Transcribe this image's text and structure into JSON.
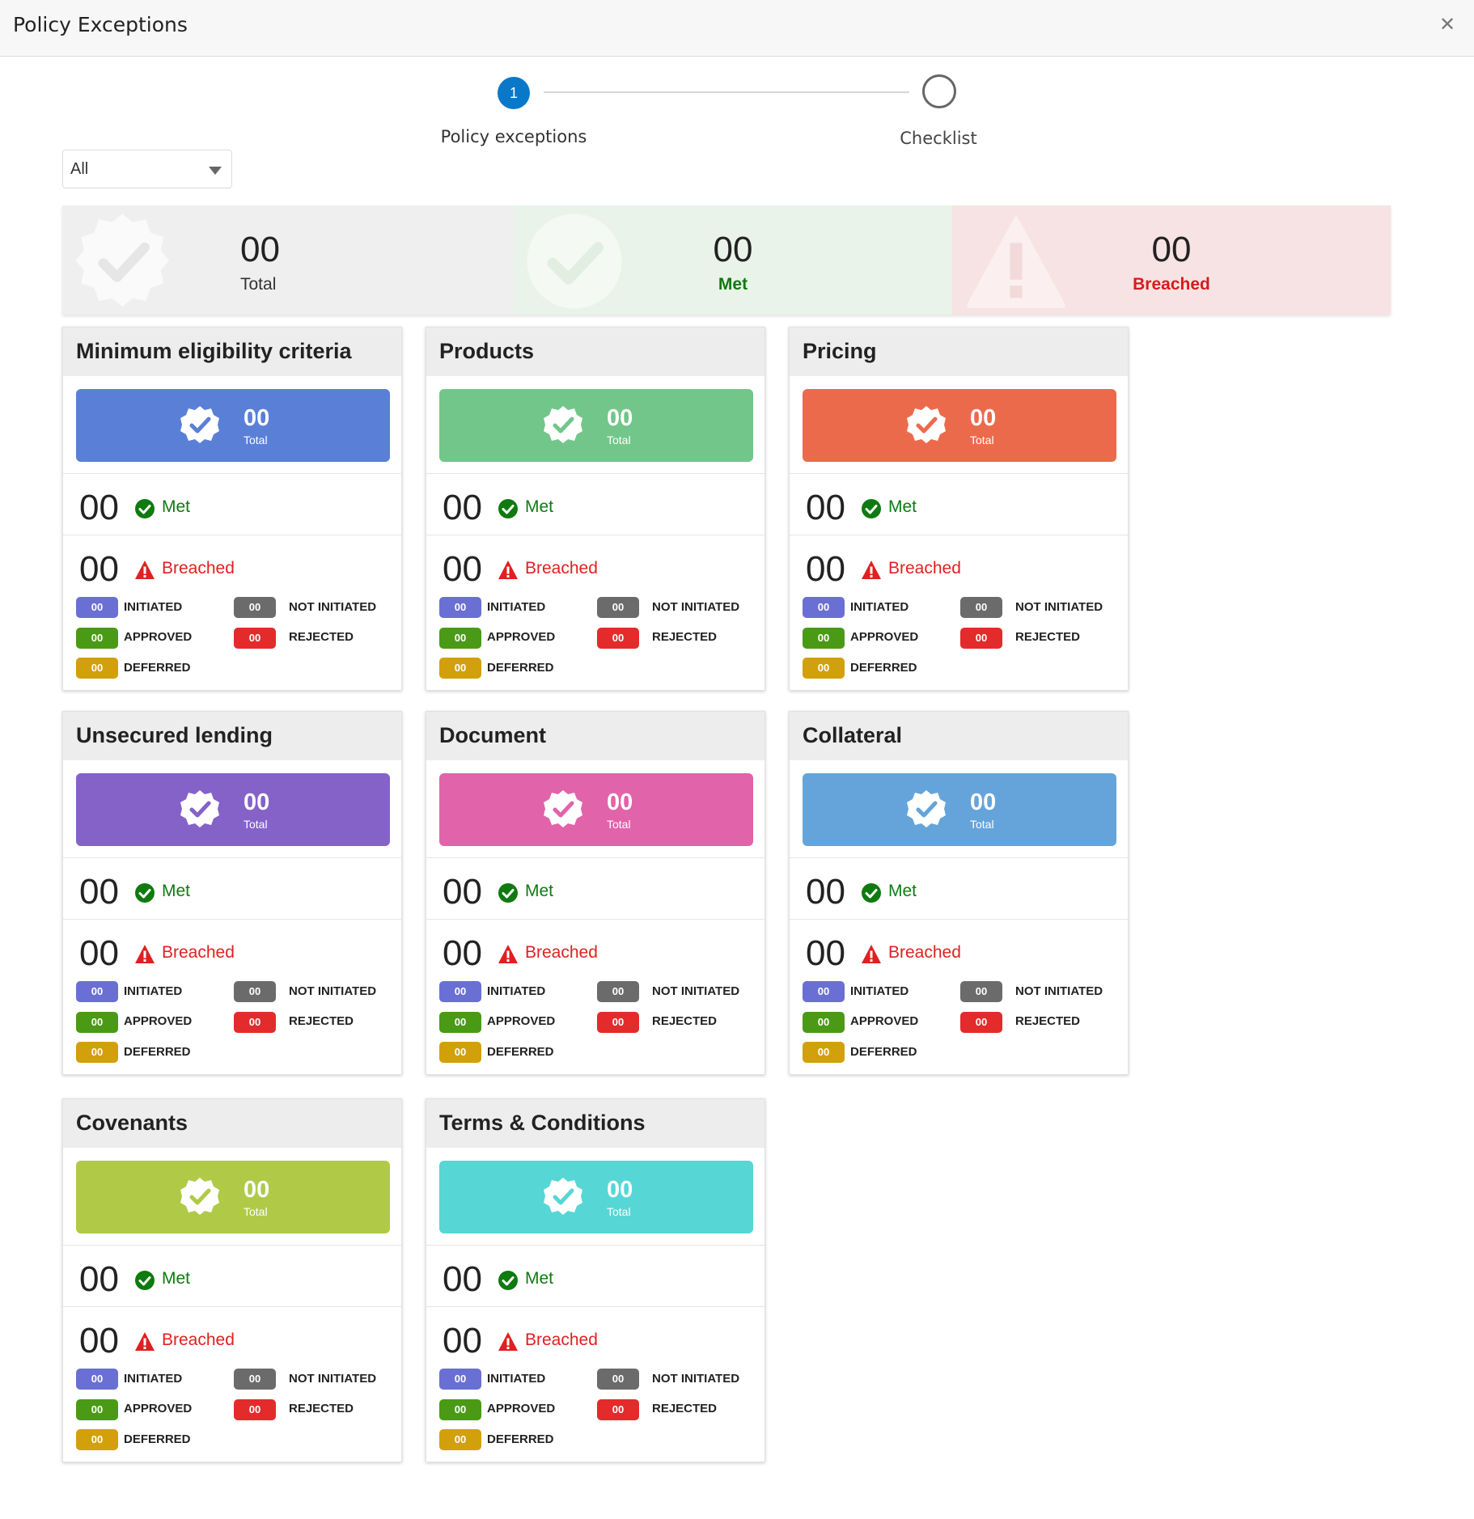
{
  "header": {
    "title": "Policy Exceptions",
    "close_icon": "close-icon"
  },
  "stepper": {
    "steps": [
      {
        "number": "1",
        "label": "Policy exceptions",
        "state": "active"
      },
      {
        "number": "",
        "label": "Checklist",
        "state": "inactive"
      }
    ],
    "active_color": "#0a78c8"
  },
  "filter": {
    "selected": "All"
  },
  "summary": {
    "total": {
      "value": "00",
      "label": "Total"
    },
    "met": {
      "value": "00",
      "label": "Met",
      "color": "#0f7a0f"
    },
    "breached": {
      "value": "00",
      "label": "Breached",
      "color": "#d81b1b"
    }
  },
  "status_colors": {
    "initiated": "#6a6fd4",
    "not_initiated": "#6b6b6b",
    "approved": "#4a9a16",
    "rejected": "#e32b2b",
    "deferred": "#d2a00a"
  },
  "cards": [
    {
      "title": "Minimum eligibility criteria",
      "color": "#5a7fd6",
      "total": "00",
      "total_label": "Total",
      "met": "00",
      "met_label": "Met",
      "breached": "00",
      "breached_label": "Breached",
      "statuses": {
        "initiated": {
          "count": "00",
          "label": "INITIATED"
        },
        "not_initiated": {
          "count": "00",
          "label": "NOT INITIATED"
        },
        "approved": {
          "count": "00",
          "label": "APPROVED"
        },
        "rejected": {
          "count": "00",
          "label": "REJECTED"
        },
        "deferred": {
          "count": "00",
          "label": "DEFERRED"
        }
      }
    },
    {
      "title": "Products",
      "color": "#72c689",
      "total": "00",
      "total_label": "Total",
      "met": "00",
      "met_label": "Met",
      "breached": "00",
      "breached_label": "Breached",
      "statuses": {
        "initiated": {
          "count": "00",
          "label": "INITIATED"
        },
        "not_initiated": {
          "count": "00",
          "label": "NOT INITIATED"
        },
        "approved": {
          "count": "00",
          "label": "APPROVED"
        },
        "rejected": {
          "count": "00",
          "label": "REJECTED"
        },
        "deferred": {
          "count": "00",
          "label": "DEFERRED"
        }
      }
    },
    {
      "title": "Pricing",
      "color": "#ec6a4c",
      "total": "00",
      "total_label": "Total",
      "met": "00",
      "met_label": "Met",
      "breached": "00",
      "breached_label": "Breached",
      "statuses": {
        "initiated": {
          "count": "00",
          "label": "INITIATED"
        },
        "not_initiated": {
          "count": "00",
          "label": "NOT INITIATED"
        },
        "approved": {
          "count": "00",
          "label": "APPROVED"
        },
        "rejected": {
          "count": "00",
          "label": "REJECTED"
        },
        "deferred": {
          "count": "00",
          "label": "DEFERRED"
        }
      }
    },
    {
      "title": "Unsecured lending",
      "color": "#8462c8",
      "total": "00",
      "total_label": "Total",
      "met": "00",
      "met_label": "Met",
      "breached": "00",
      "breached_label": "Breached",
      "statuses": {
        "initiated": {
          "count": "00",
          "label": "INITIATED"
        },
        "not_initiated": {
          "count": "00",
          "label": "NOT INITIATED"
        },
        "approved": {
          "count": "00",
          "label": "APPROVED"
        },
        "rejected": {
          "count": "00",
          "label": "REJECTED"
        },
        "deferred": {
          "count": "00",
          "label": "DEFERRED"
        }
      }
    },
    {
      "title": "Document",
      "color": "#e163aa",
      "total": "00",
      "total_label": "Total",
      "met": "00",
      "met_label": "Met",
      "breached": "00",
      "breached_label": "Breached",
      "statuses": {
        "initiated": {
          "count": "00",
          "label": "INITIATED"
        },
        "not_initiated": {
          "count": "00",
          "label": "NOT INITIATED"
        },
        "approved": {
          "count": "00",
          "label": "APPROVED"
        },
        "rejected": {
          "count": "00",
          "label": "REJECTED"
        },
        "deferred": {
          "count": "00",
          "label": "DEFERRED"
        }
      }
    },
    {
      "title": "Collateral",
      "color": "#64a4da",
      "total": "00",
      "total_label": "Total",
      "met": "00",
      "met_label": "Met",
      "breached": "00",
      "breached_label": "Breached",
      "statuses": {
        "initiated": {
          "count": "00",
          "label": "INITIATED"
        },
        "not_initiated": {
          "count": "00",
          "label": "NOT INITIATED"
        },
        "approved": {
          "count": "00",
          "label": "APPROVED"
        },
        "rejected": {
          "count": "00",
          "label": "REJECTED"
        },
        "deferred": {
          "count": "00",
          "label": "DEFERRED"
        }
      }
    },
    {
      "title": "Covenants",
      "color": "#b0ca48",
      "total": "00",
      "total_label": "Total",
      "met": "00",
      "met_label": "Met",
      "breached": "00",
      "breached_label": "Breached",
      "statuses": {
        "initiated": {
          "count": "00",
          "label": "INITIATED"
        },
        "not_initiated": {
          "count": "00",
          "label": "NOT INITIATED"
        },
        "approved": {
          "count": "00",
          "label": "APPROVED"
        },
        "rejected": {
          "count": "00",
          "label": "REJECTED"
        },
        "deferred": {
          "count": "00",
          "label": "DEFERRED"
        }
      }
    },
    {
      "title": "Terms & Conditions",
      "color": "#57d6d6",
      "total": "00",
      "total_label": "Total",
      "met": "00",
      "met_label": "Met",
      "breached": "00",
      "breached_label": "Breached",
      "statuses": {
        "initiated": {
          "count": "00",
          "label": "INITIATED"
        },
        "not_initiated": {
          "count": "00",
          "label": "NOT INITIATED"
        },
        "approved": {
          "count": "00",
          "label": "APPROVED"
        },
        "rejected": {
          "count": "00",
          "label": "REJECTED"
        },
        "deferred": {
          "count": "00",
          "label": "DEFERRED"
        }
      }
    }
  ]
}
